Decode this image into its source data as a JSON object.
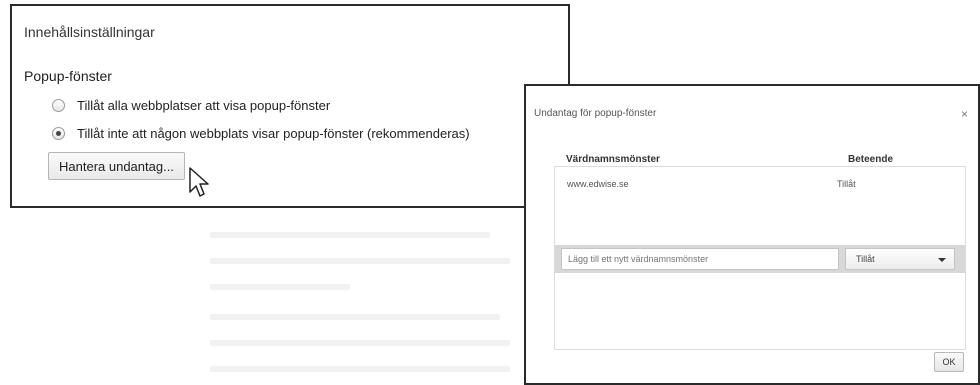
{
  "settings": {
    "title": "Innehållsinställningar",
    "section_title": "Popup-fönster",
    "options": [
      {
        "label": "Tillåt alla webbplatser att visa popup-fönster",
        "checked": false
      },
      {
        "label": "Tillåt inte att någon webbplats visar popup-fönster (rekommenderas)",
        "checked": true
      }
    ],
    "manage_button": "Hantera undantag..."
  },
  "dialog": {
    "title": "Undantag för popup-fönster",
    "close": "×",
    "columns": {
      "name": "Värdnamnsmönster",
      "behavior": "Beteende"
    },
    "rows": [
      {
        "name": "www.edwise.se",
        "behavior": "Tillåt"
      }
    ],
    "add_placeholder": "Lägg till ett nytt värdnamnsmönster",
    "add_behavior": "Tillåt",
    "ok": "OK"
  }
}
